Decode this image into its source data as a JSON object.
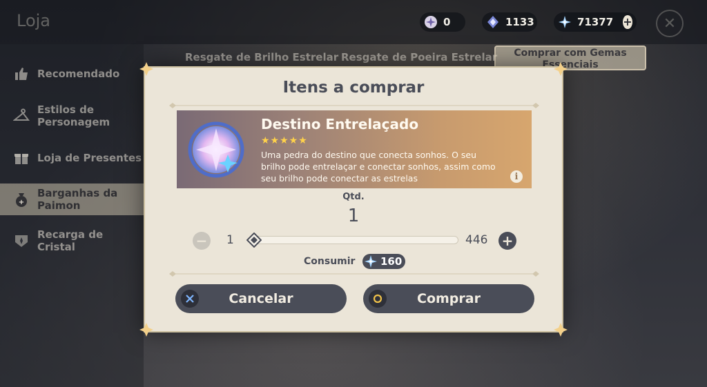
{
  "shop": {
    "title": "Loja"
  },
  "currencies": [
    {
      "name": "masterless-starglitter",
      "value": "0"
    },
    {
      "name": "masterless-stardust",
      "value": "1133"
    },
    {
      "name": "primogem",
      "value": "71377"
    }
  ],
  "tabs": [
    {
      "label": "Resgate de Brilho Estrelar"
    },
    {
      "label": "Resgate de Poeira Estrelar"
    },
    {
      "label": "Comprar com Gemas Essenciais"
    }
  ],
  "sidebar": {
    "items": [
      {
        "label": "Recomendado",
        "icon": "thumbs-up-icon"
      },
      {
        "label": "Estilos de Personagem",
        "icon": "hanger-icon"
      },
      {
        "label": "Loja de Presentes",
        "icon": "gift-icon"
      },
      {
        "label": "Barganhas da Paimon",
        "icon": "bag-icon"
      },
      {
        "label": "Recarga de Cristal",
        "icon": "crystal-icon"
      }
    ]
  },
  "dialog": {
    "title": "Itens a comprar",
    "item": {
      "name": "Destino Entrelaçado",
      "stars": "★★★★★",
      "rarity": 5,
      "description": "Uma pedra do destino que conecta sonhos. O seu brilho pode entrelaçar e conectar sonhos, assim como seu brilho pode conectar as estrelas"
    },
    "quantity_label": "Qtd.",
    "quantity": "1",
    "slider_min": "1",
    "slider_max": "446",
    "consume_label": "Consumir",
    "cost": "160",
    "cancel_label": "Cancelar",
    "confirm_label": "Comprar"
  },
  "colors": {
    "panel": "#ebe5d8",
    "button": "#4a4d58",
    "gold": "#d7a66e",
    "star": "#ffd24a"
  }
}
